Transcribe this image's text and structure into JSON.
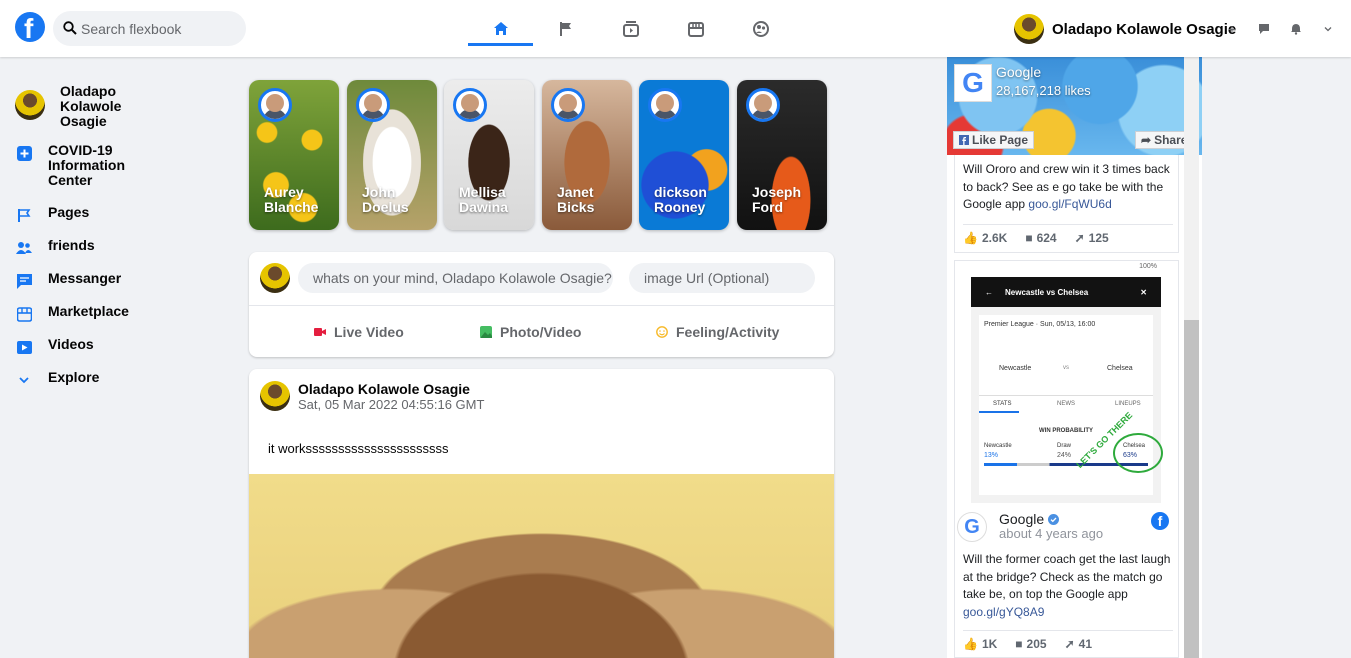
{
  "header": {
    "logo": "f",
    "search_placeholder": "Search flexbook",
    "nav": [
      "home-icon",
      "flag-icon",
      "watch-icon",
      "marketplace-icon",
      "groups-icon"
    ],
    "profile_name": "Oladapo Kolawole Osagie",
    "actions": [
      "+",
      "messenger-icon",
      "bell-icon",
      "chevron-down-icon"
    ],
    "accent": "#1877f2"
  },
  "sidebar": {
    "user": "Oladapo Kolawole Osagie",
    "items": [
      {
        "label": "COVID-19 Information Center",
        "icon": "plus-square-icon"
      },
      {
        "label": "Pages",
        "icon": "flag-icon"
      },
      {
        "label": "friends",
        "icon": "people-icon"
      },
      {
        "label": "Messanger",
        "icon": "message-icon"
      },
      {
        "label": "Marketplace",
        "icon": "store-icon"
      },
      {
        "label": "Videos",
        "icon": "video-icon"
      },
      {
        "label": "Explore",
        "icon": "chevron-down-icon"
      }
    ]
  },
  "stories": [
    {
      "name": "Aurey Blanche"
    },
    {
      "name": "John Doelus"
    },
    {
      "name": "Mellisa Dawina"
    },
    {
      "name": "Janet Bicks"
    },
    {
      "name": "dickson Rooney"
    },
    {
      "name": "Joseph Ford"
    }
  ],
  "composer": {
    "text_placeholder": "whats on your mind, Oladapo Kolawole Osagie?",
    "url_placeholder": "image Url (Optional)",
    "actions": {
      "live": "Live Video",
      "photo": "Photo/Video",
      "feeling": "Feeling/Activity"
    }
  },
  "post": {
    "author": "Oladapo Kolawole Osagie",
    "date": "Sat, 05 Mar 2022 04:55:16 GMT",
    "text": "it workssssssssssssssssssssss"
  },
  "ads": {
    "page_name": "Google",
    "likes": "28,167,218 likes",
    "like_page": "Like Page",
    "share": "Share",
    "post1": {
      "text": "Will Ororo and crew win it 3 times back to back? See as e go take be with the Google app ",
      "link": "goo.gl/FqWU6d",
      "likes": "2.6K",
      "comments": "624",
      "shares": "125"
    },
    "phone": {
      "status": "100%",
      "title": "Newcastle vs Chelsea",
      "league": "Premier League · Sun, 05/13, 16:00",
      "home": "Newcastle",
      "vs": "vs",
      "away": "Chelsea",
      "tabs": [
        "STATS",
        "NEWS",
        "LINEUPS"
      ],
      "win_prob": "WIN PROBABILITY",
      "teams": [
        "Newcastle",
        "Draw",
        "Chelsea"
      ],
      "pcts": [
        "13%",
        "24%",
        "63%"
      ],
      "scribble": "LET'S GO THERE"
    },
    "post2": {
      "name": "Google",
      "time": "about 4 years ago",
      "text": "Will the former coach get the last laugh at the bridge? Check as the match go take be, on top the Google app ",
      "link": "goo.gl/gYQ8A9",
      "likes": "1K",
      "comments": "205",
      "shares": "41"
    }
  }
}
